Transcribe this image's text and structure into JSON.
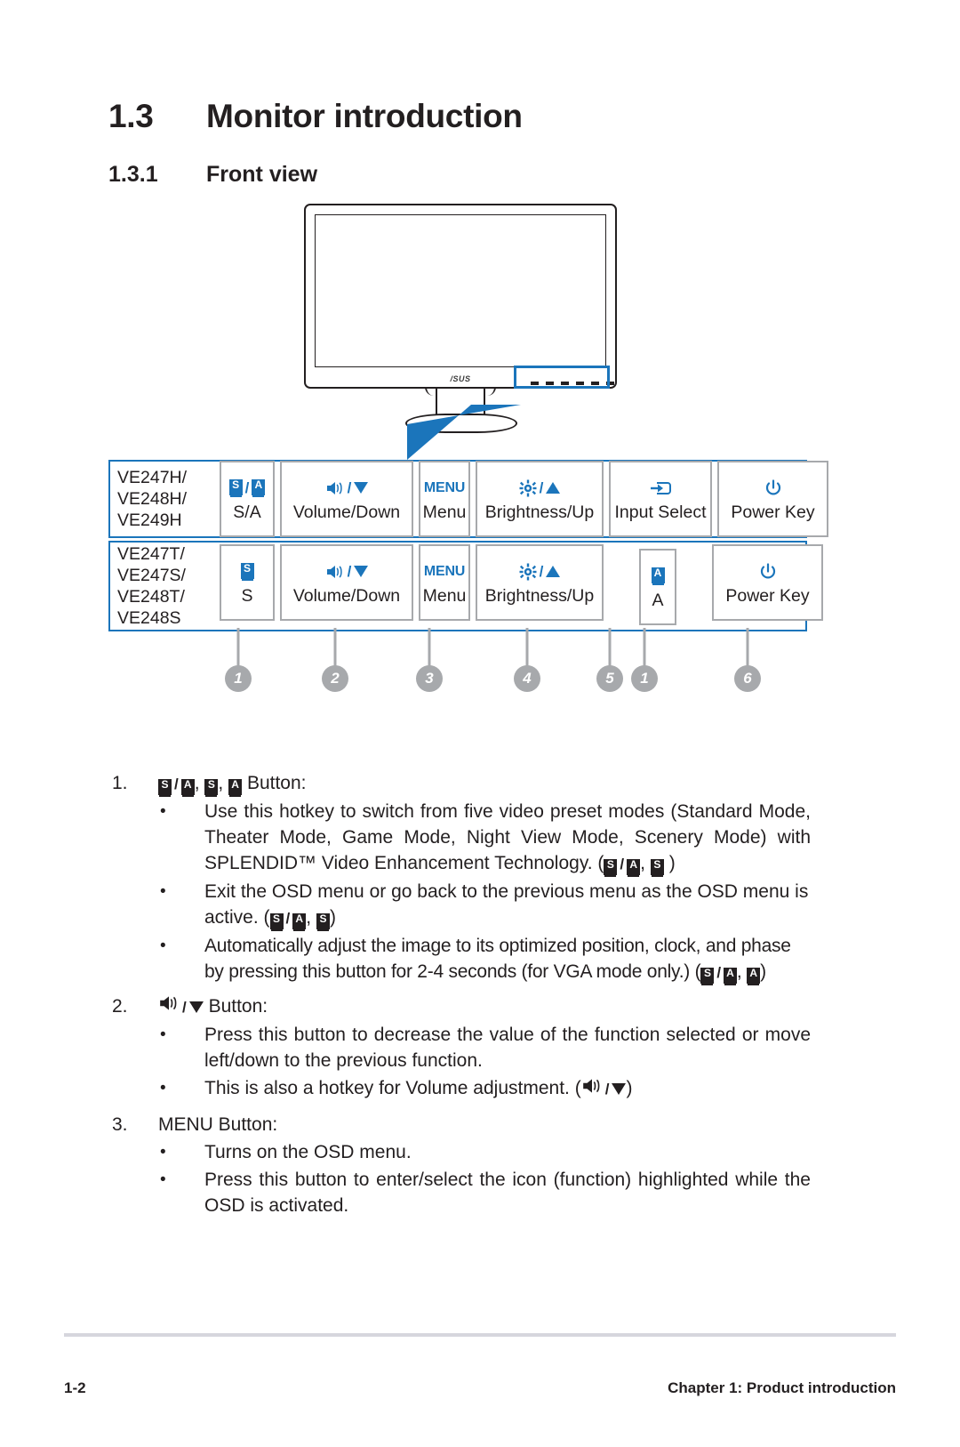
{
  "heading": {
    "section_number": "1.3",
    "section_title": "Monitor introduction",
    "sub_number": "1.3.1",
    "sub_title": "Front view"
  },
  "illustration": {
    "brand_logo": "/SUS",
    "highlight_color": "#1b75bb",
    "callout_arrow": "arrow-pointing-to-buttons"
  },
  "table": {
    "rows": [
      {
        "models": [
          "VE247H/",
          "VE248H/",
          "VE249H"
        ],
        "cells": [
          {
            "glyph": "s-slash-a-key-icons",
            "label": "S/A"
          },
          {
            "glyph": "speaker-slash-down-triangle-icon",
            "label": "Volume/Down"
          },
          {
            "glyph": "MENU",
            "label": "Menu"
          },
          {
            "glyph": "brightness-slash-up-triangle-icon",
            "label": "Brightness/Up"
          },
          {
            "glyph": "input-select-icon",
            "label": "Input Select"
          },
          {
            "glyph": "power-icon",
            "label": "Power Key"
          }
        ]
      },
      {
        "models": [
          "VE247T/",
          "VE247S/",
          "VE248T/",
          "VE248S"
        ],
        "cells": [
          {
            "glyph": "s-key-icon",
            "label": "S"
          },
          {
            "glyph": "speaker-slash-down-triangle-icon",
            "label": "Volume/Down"
          },
          {
            "glyph": "MENU",
            "label": "Menu"
          },
          {
            "glyph": "brightness-slash-up-triangle-icon",
            "label": "Brightness/Up"
          },
          {
            "glyph": "a-key-icon",
            "label": "A"
          },
          {
            "glyph": "power-icon",
            "label": "Power Key"
          }
        ]
      }
    ],
    "callout_numbers": [
      "1",
      "2",
      "3",
      "4",
      "5",
      "1",
      "6"
    ]
  },
  "items": [
    {
      "index": "1.",
      "title_suffix": "Button:",
      "bullets": [
        "Use this hotkey to switch from five video preset modes (Standard Mode, Theater Mode, Game Mode, Night View Mode, Scenery Mode) with SPLENDID™ Video Enhancement Technology. (",
        "Exit the OSD menu or go back to the previous menu as the OSD menu is active. (",
        "Automatically adjust the image to its optimized position, clock, and phase by pressing this button for 2-4 seconds (for VGA mode only.) ("
      ],
      "bullet_parts": {
        "b1_a": "Use this hotkey to switch from five video preset modes (Standard Mode, Theater Mode, Game Mode, Night View Mode, Scenery Mode) with SPLENDID™ Video Enhancement Technology. (",
        "b1_b": ")",
        "b2_a": "Exit the OSD menu or go back to the previous menu as the OSD menu is active. (",
        "b2_b": ")",
        "b3_a": "Automatically adjust the image to its optimized position, clock, and phase by pressing this button for 2-4 seconds (for VGA mode only.) (",
        "b3_b": ")"
      }
    },
    {
      "index": "2.",
      "title_suffix": "Button:",
      "bullet_parts": {
        "b1": "Press this button to decrease the value of the function selected or move left/down to the previous function.",
        "b2_a": "This is also a hotkey for Volume adjustment. (",
        "b2_b": ")"
      }
    },
    {
      "index": "3.",
      "title": "MENU Button:",
      "bullet_parts": {
        "b1": "Turns on the OSD menu.",
        "b2": "Press this button to enter/select the icon (function) highlighted while the OSD is activated."
      }
    }
  ],
  "glyph_letters": {
    "s": "S",
    "a": "A",
    "slash": "/",
    "comma": ",",
    "menu": "MENU"
  },
  "footer": {
    "page_number": "1-2",
    "chapter": "Chapter 1: Product introduction"
  }
}
